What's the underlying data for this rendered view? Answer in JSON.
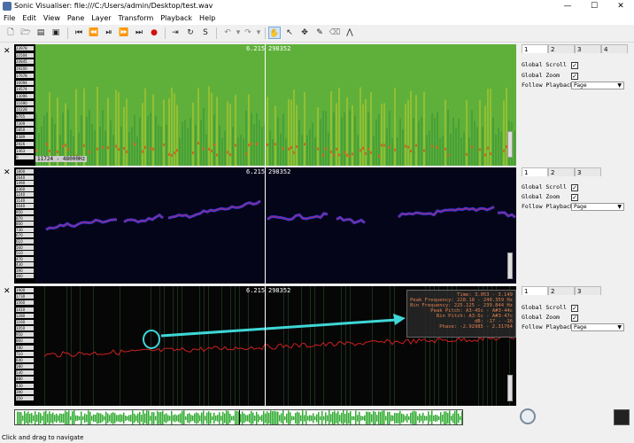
{
  "window": {
    "title": "Sonic Visualiser: file:///C:/Users/admin/Desktop/test.wav",
    "minimize": "—",
    "maximize": "☐",
    "close": "✕"
  },
  "menu": [
    "File",
    "Edit",
    "View",
    "Pane",
    "Layer",
    "Transform",
    "Playback",
    "Help"
  ],
  "panes": [
    {
      "close": "✕",
      "time_readout": "6.215",
      "frame_readout": "298352",
      "range_readout": "11724 - 48000Hz",
      "scale_ticks": [
        "23978",
        "22504",
        "20845",
        "19200",
        "17678",
        "16094",
        "14574",
        "13096",
        "11690",
        "10228",
        "8765",
        "7309",
        "5850",
        "4389",
        "2926",
        "1463",
        "0"
      ],
      "tabs": [
        "1",
        "2",
        "3",
        "4"
      ],
      "properties": {
        "global_scroll_label": "Global Scroll",
        "global_scroll": "✓",
        "global_zoom_label": "Global Zoom",
        "global_zoom": "✓",
        "follow_playback_label": "Follow Playback",
        "follow_playback_value": "Page"
      }
    },
    {
      "close": "✕",
      "time_readout": "6.215",
      "frame_readout": "298352",
      "scale_ticks": [
        "1800",
        "1640",
        "1490",
        "1360",
        "1240",
        "1140",
        "1040",
        "950",
        "870",
        "800",
        "730",
        "670",
        "610",
        "560",
        "510",
        "470",
        "430",
        "390",
        "360"
      ],
      "tabs": [
        "1",
        "2",
        "3"
      ],
      "properties": {
        "global_scroll_label": "Global Scroll",
        "global_scroll": "✓",
        "global_zoom_label": "Global Zoom",
        "global_zoom": "✓",
        "follow_playback_label": "Follow Playback",
        "follow_playback_value": "Page"
      }
    },
    {
      "close": "✕",
      "time_readout": "6.215",
      "frame_readout": "298352",
      "scale_ticks": [
        "1900",
        "1730",
        "1560",
        "1410",
        "1280",
        "1160",
        "1050",
        "950",
        "860",
        "780",
        "710",
        "640",
        "580",
        "530",
        "480",
        "430",
        "390",
        "350"
      ],
      "tabs": [
        "1",
        "2",
        "3"
      ],
      "properties": {
        "global_scroll_label": "Global Scroll",
        "global_scroll": "✓",
        "global_zoom_label": "Global Zoom",
        "global_zoom": "✓",
        "follow_playback_label": "Follow Playback",
        "follow_playback_value": "Page"
      },
      "readout": [
        "Time: 3.053 - 3.149",
        "Peak Frequency: 228.18 - 240.359 Hz",
        "Bin Frequency: 225.125 - 239.844 Hz",
        "Peak Pitch: A3-45c - A#3-44c",
        "Bin Pitch: A3-5c - A#3-47c",
        "dB: -17 - -16",
        "Phase: -2.92985 - 2.31764"
      ]
    }
  ],
  "status": "Click and drag to navigate",
  "colors": {
    "spectrogram_green": "#4aa832",
    "pitch_blue": "#3a3ae8",
    "pitch_red": "#d02020",
    "annotation_cyan": "#3fd6d6",
    "waveform_green": "#2faa2f"
  }
}
